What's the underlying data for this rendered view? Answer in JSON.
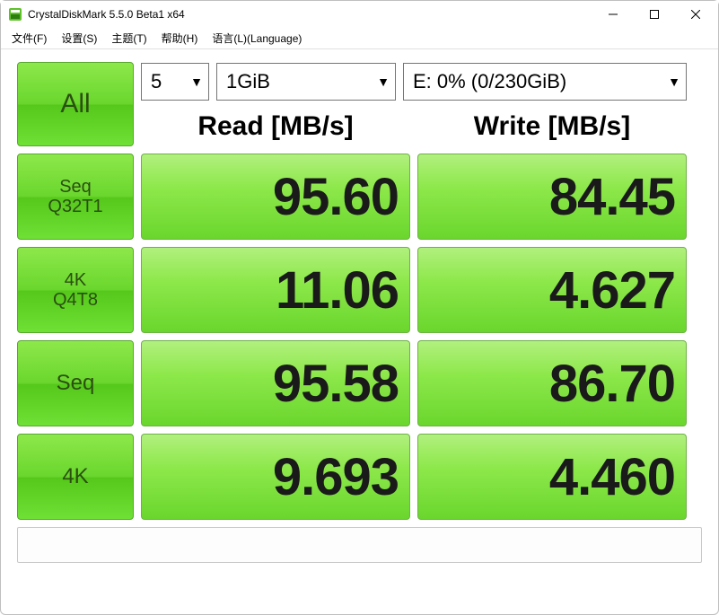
{
  "window": {
    "title": "CrystalDiskMark 5.5.0 Beta1 x64"
  },
  "menu": {
    "file": "文件(F)",
    "settings": "设置(S)",
    "theme": "主题(T)",
    "help": "帮助(H)",
    "lang": "语言(L)(Language)"
  },
  "controls": {
    "all": "All",
    "count": "5",
    "size": "1GiB",
    "drive": "E: 0% (0/230GiB)"
  },
  "headers": {
    "read": "Read [MB/s]",
    "write": "Write [MB/s]"
  },
  "tests": [
    {
      "label1": "Seq",
      "label2": "Q32T1",
      "read": "95.60",
      "write": "84.45"
    },
    {
      "label1": "4K",
      "label2": "Q4T8",
      "read": "11.06",
      "write": "4.627"
    },
    {
      "label1": "Seq",
      "label2": "",
      "read": "95.58",
      "write": "86.70"
    },
    {
      "label1": "4K",
      "label2": "",
      "read": "9.693",
      "write": "4.460"
    }
  ],
  "statusbar": ""
}
